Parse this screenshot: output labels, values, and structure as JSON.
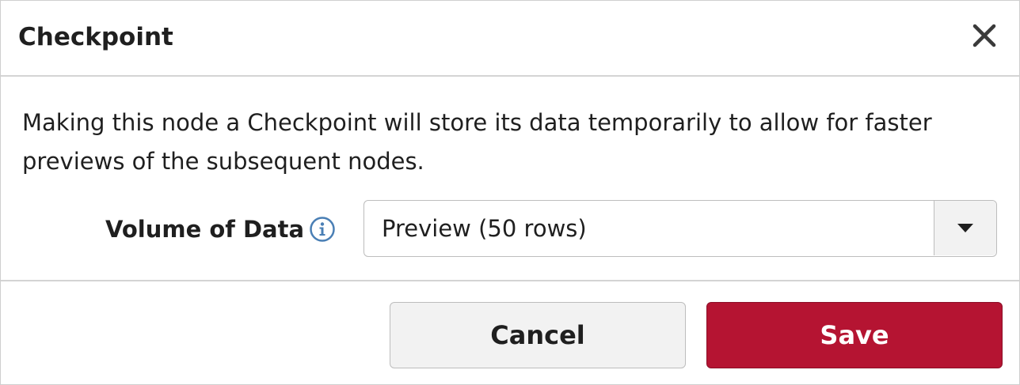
{
  "dialog": {
    "title": "Checkpoint",
    "close_icon": "close-icon",
    "description": "Making this node a Checkpoint will store its data temporarily to allow for faster previews of the subsequent nodes."
  },
  "volume_field": {
    "label": "Volume of Data",
    "info_icon": "info-icon",
    "selected_value": "Preview (50 rows)",
    "dropdown_icon": "caret-down-icon"
  },
  "footer": {
    "cancel_label": "Cancel",
    "save_label": "Save"
  },
  "colors": {
    "accent": "#b51432",
    "info_icon": "#4a7fb5",
    "text": "#1f1f1f",
    "border": "#bdbdbd"
  }
}
